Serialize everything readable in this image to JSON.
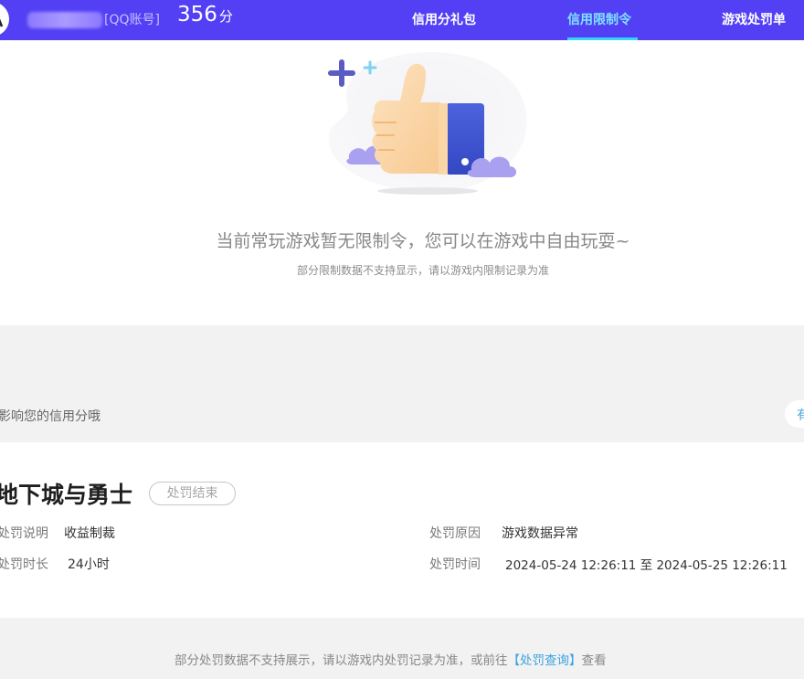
{
  "header": {
    "account_type": "[QQ账号]",
    "score_value": "356",
    "score_unit": "分",
    "tabs": [
      {
        "label": "信用分礼包",
        "active": false
      },
      {
        "label": "信用限制令",
        "active": true
      },
      {
        "label": "游戏处罚单",
        "active": false
      }
    ],
    "bg_color": "#5340f5",
    "active_tab_color": "#7fe3ff"
  },
  "empty_state": {
    "illustration": "thumbs-up-icon",
    "title": "当前常玩游戏暂无限制令，您可以在游戏中自由玩耍~",
    "note": "部分限制数据不支持显示，请以游戏内限制记录为准"
  },
  "notice": {
    "text": "影响您的信用分哦",
    "side_label": "有"
  },
  "punishment": {
    "game_name": "地下城与勇士",
    "status": "处罚结束",
    "fields": [
      {
        "label": "处罚说明",
        "value": "收益制裁"
      },
      {
        "label": "处罚原因",
        "value": "游戏数据异常"
      },
      {
        "label": "处罚时长",
        "value": "24小时"
      },
      {
        "label": "处罚时间",
        "value": "2024-05-24 12:26:11 至 2024-05-25 12:26:11"
      }
    ]
  },
  "footer": {
    "text_before": "部分处罚数据不支持展示，请以游戏内处罚记录为准，或前往",
    "link_label": "【处罚查询】",
    "text_after": "查看",
    "link_color": "#3aa4e0"
  }
}
